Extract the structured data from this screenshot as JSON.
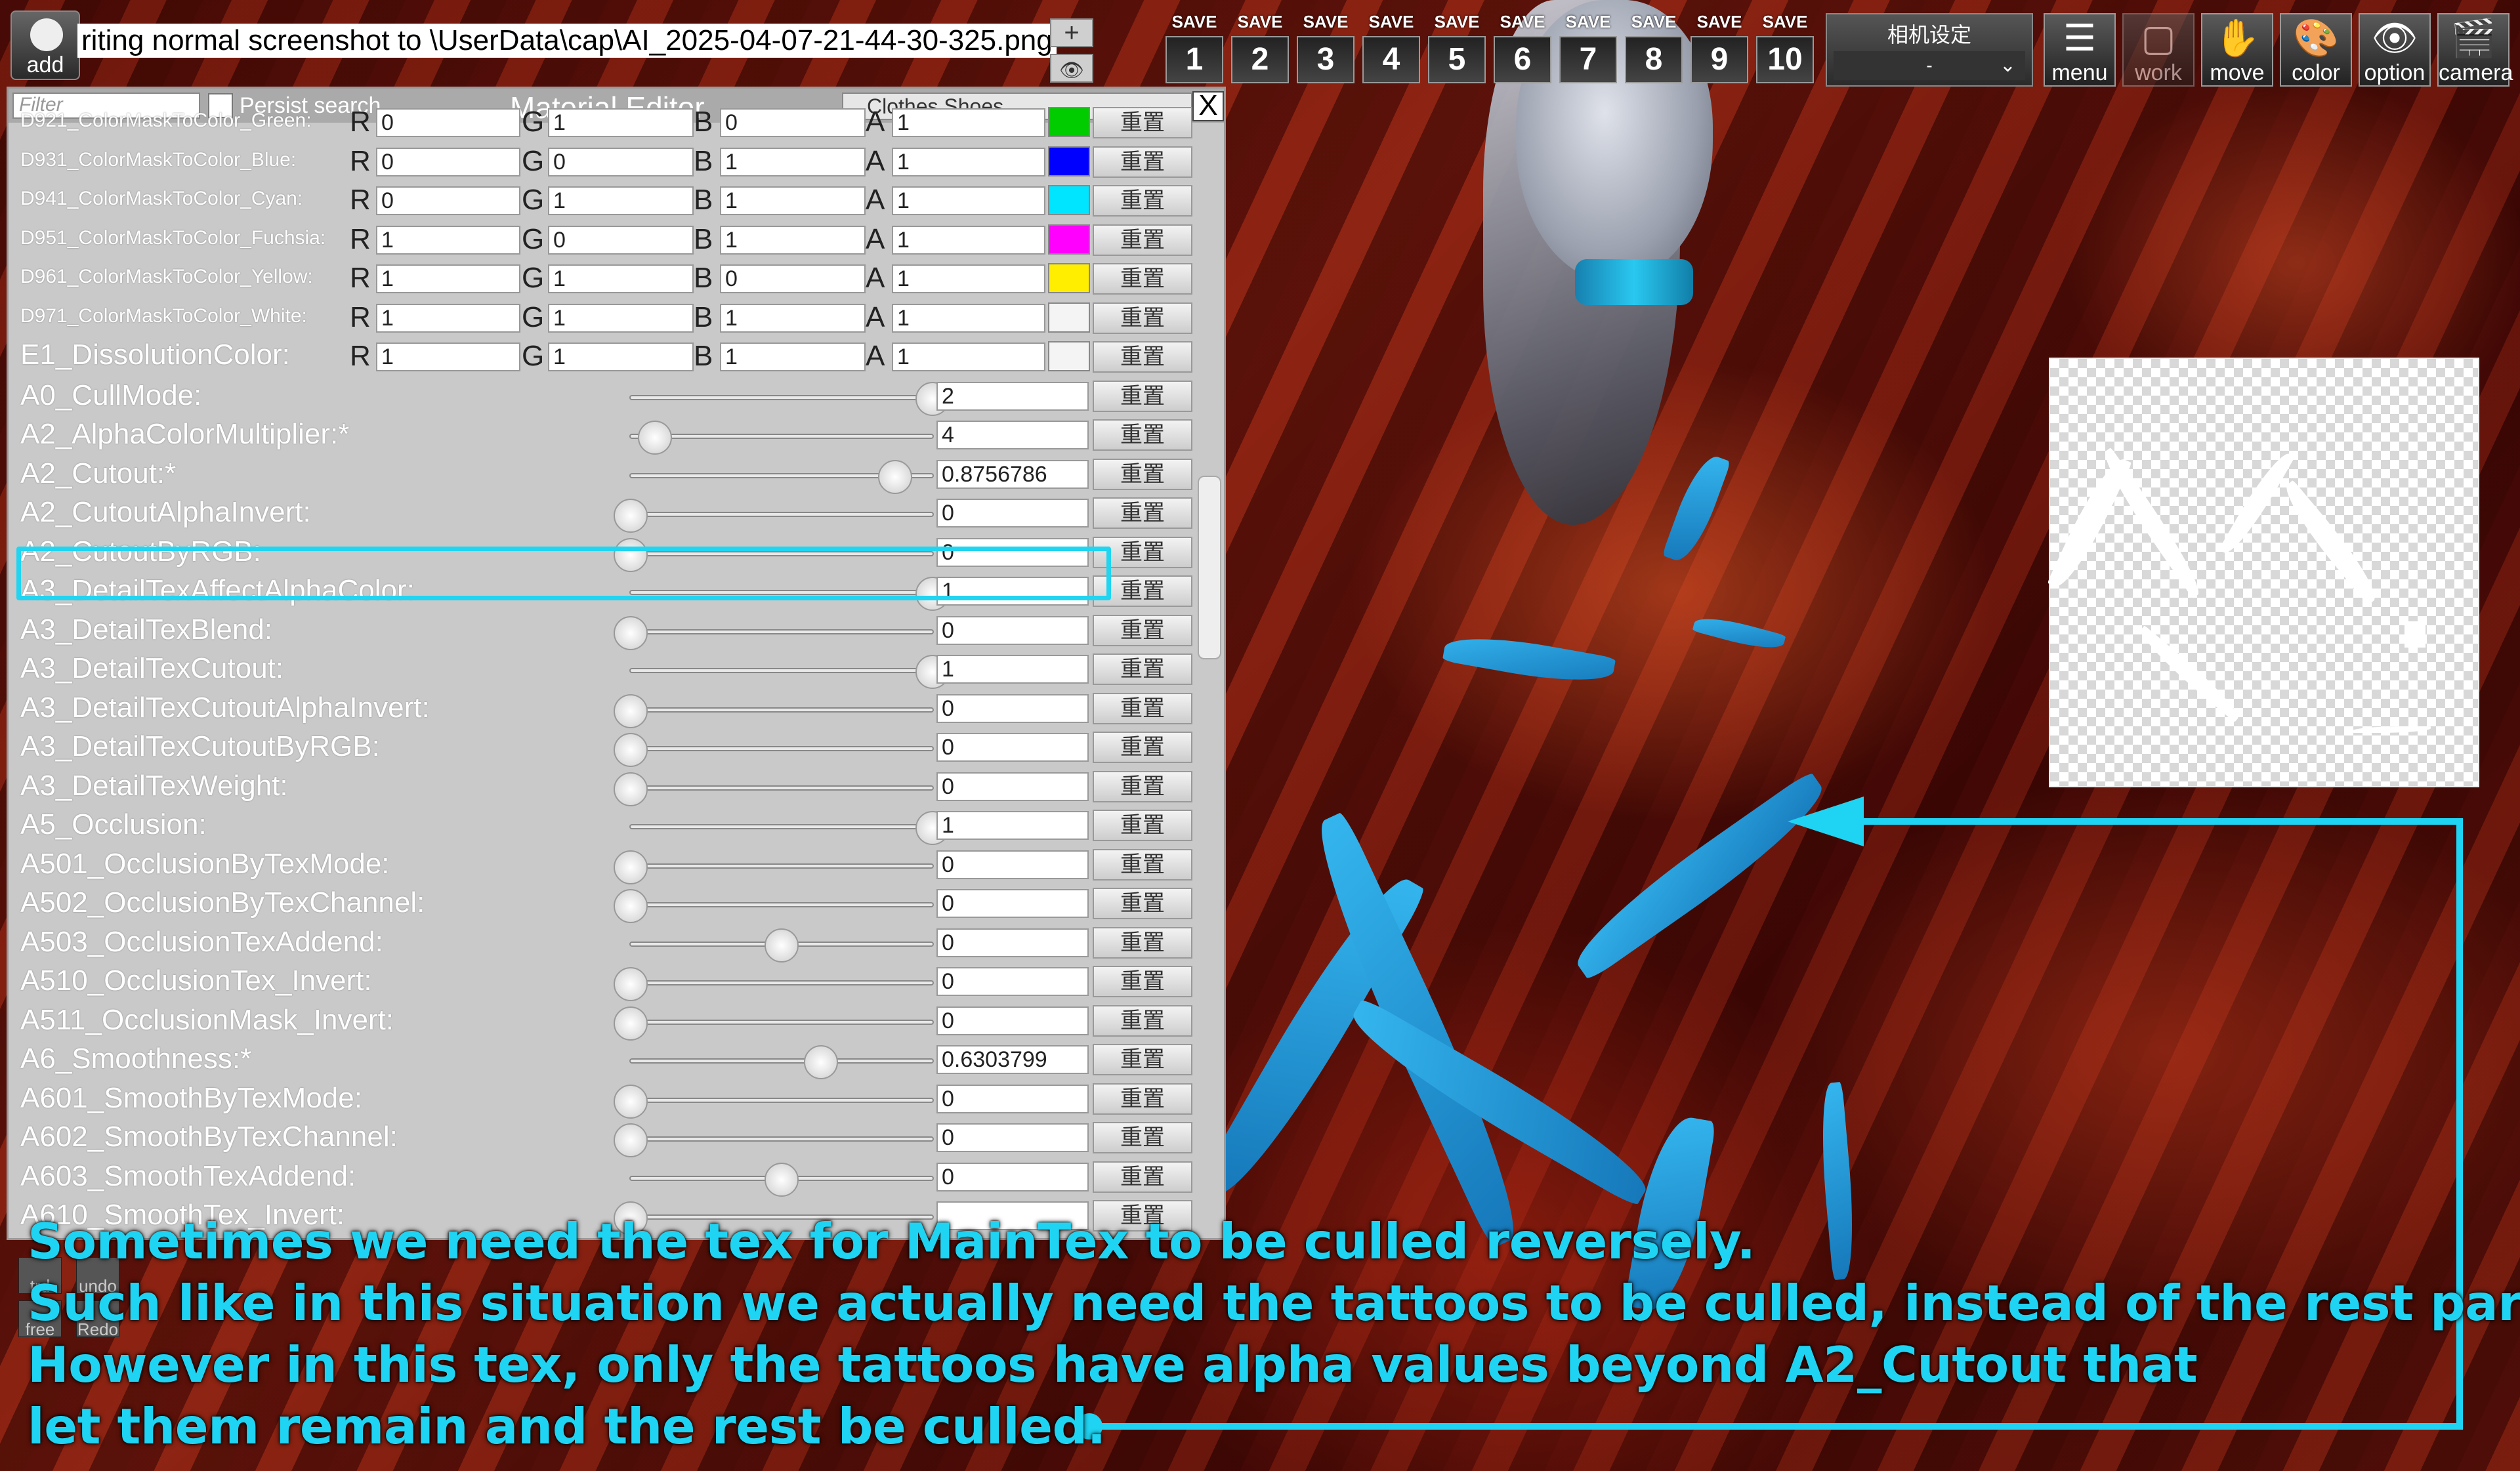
{
  "toolbar": {
    "add_label": "add",
    "status_text": "riting normal screenshot to \\UserData\\cap\\AI_2025-04-07-21-44-30-325.png",
    "plus_label": "+",
    "eye_label": "👁",
    "save_label": "SAVE",
    "save_slots": [
      "1",
      "2",
      "3",
      "4",
      "5",
      "6",
      "7",
      "8",
      "9",
      "10"
    ],
    "camera_settings_title": "相机设定",
    "camera_settings_value": "-",
    "menu_label": "menu",
    "work_label": "work",
    "move_label": "move",
    "color_label": "color",
    "option_label": "option",
    "camera_label": "camera"
  },
  "editor": {
    "filter_placeholder": "Filter",
    "persist_label": "Persist search",
    "title": "Material Editor",
    "category": "Clothes Shoes",
    "close_label": "X",
    "reset_label": "重置",
    "color_rows": [
      {
        "name": "D921_ColorMaskToColor_Green:",
        "r": "0",
        "g": "1",
        "b": "0",
        "a": "1",
        "swatch": "#00cc00"
      },
      {
        "name": "D931_ColorMaskToColor_Blue:",
        "r": "0",
        "g": "0",
        "b": "1",
        "a": "1",
        "swatch": "#0000ff"
      },
      {
        "name": "D941_ColorMaskToColor_Cyan:",
        "r": "0",
        "g": "1",
        "b": "1",
        "a": "1",
        "swatch": "#00e5ff"
      },
      {
        "name": "D951_ColorMaskToColor_Fuchsia:",
        "r": "1",
        "g": "0",
        "b": "1",
        "a": "1",
        "swatch": "#ff00ff"
      },
      {
        "name": "D961_ColorMaskToColor_Yellow:",
        "r": "1",
        "g": "1",
        "b": "0",
        "a": "1",
        "swatch": "#ffee00"
      },
      {
        "name": "D971_ColorMaskToColor_White:",
        "r": "1",
        "g": "1",
        "b": "1",
        "a": "1",
        "swatch": "#f4f4f4"
      },
      {
        "name": "E1_DissolutionColor:",
        "r": "1",
        "g": "1",
        "b": "1",
        "a": "1",
        "swatch": "#f4f4f4"
      }
    ],
    "channel_labels": {
      "r": "R",
      "g": "G",
      "b": "B",
      "a": "A"
    },
    "slider_rows": [
      {
        "name": "A0_CullMode:",
        "value": "2",
        "level": 1.0
      },
      {
        "name": "A2_AlphaColorMultiplier:*",
        "value": "4",
        "level": 0.08
      },
      {
        "name": "A2_Cutout:*",
        "value": "0.8756786",
        "level": 0.8757
      },
      {
        "name": "A2_CutoutAlphaInvert:",
        "value": "0",
        "level": 0.0
      },
      {
        "name": "A2_CutoutByRGB:",
        "value": "0",
        "level": 0.0
      },
      {
        "name": "A3_DetailTexAffectAlphaColor:",
        "value": "1",
        "level": 1.0
      },
      {
        "name": "A3_DetailTexBlend:",
        "value": "0",
        "level": 0.0
      },
      {
        "name": "A3_DetailTexCutout:",
        "value": "1",
        "level": 1.0
      },
      {
        "name": "A3_DetailTexCutoutAlphaInvert:",
        "value": "0",
        "level": 0.0
      },
      {
        "name": "A3_DetailTexCutoutByRGB:",
        "value": "0",
        "level": 0.0
      },
      {
        "name": "A3_DetailTexWeight:",
        "value": "0",
        "level": 0.0
      },
      {
        "name": "A5_Occlusion:",
        "value": "1",
        "level": 1.0
      },
      {
        "name": "A501_OcclusionByTexMode:",
        "value": "0",
        "level": 0.0
      },
      {
        "name": "A502_OcclusionByTexChannel:",
        "value": "0",
        "level": 0.0
      },
      {
        "name": "A503_OcclusionTexAddend:",
        "value": "0",
        "level": 0.5
      },
      {
        "name": "A510_OcclusionTex_Invert:",
        "value": "0",
        "level": 0.0
      },
      {
        "name": "A511_OcclusionMask_Invert:",
        "value": "0",
        "level": 0.0
      },
      {
        "name": "A6_Smoothness:*",
        "value": "0.6303799",
        "level": 0.6304
      },
      {
        "name": "A601_SmoothByTexMode:",
        "value": "0",
        "level": 0.0
      },
      {
        "name": "A602_SmoothByTexChannel:",
        "value": "0",
        "level": 0.0
      },
      {
        "name": "A603_SmoothTexAddend:",
        "value": "0",
        "level": 0.5
      },
      {
        "name": "A610_SmoothTex_Invert:",
        "value": "",
        "level": 0.0
      }
    ]
  },
  "left_buttons": {
    "undo": "undo",
    "redo": "Redo",
    "free": "free",
    "trd": "trd"
  },
  "annotation": {
    "line1": "Sometimes we need the tex for MainTex to be culled reversely.",
    "line2": "Such like in this situation we actually need the tattoos to be culled, instead of the rest part.",
    "line3": "However in this tex, only the tattoos have alpha values beyond A2_Cutout that",
    "line4": "let them remain and the rest be culled.",
    "color": "#1fd4f2"
  }
}
